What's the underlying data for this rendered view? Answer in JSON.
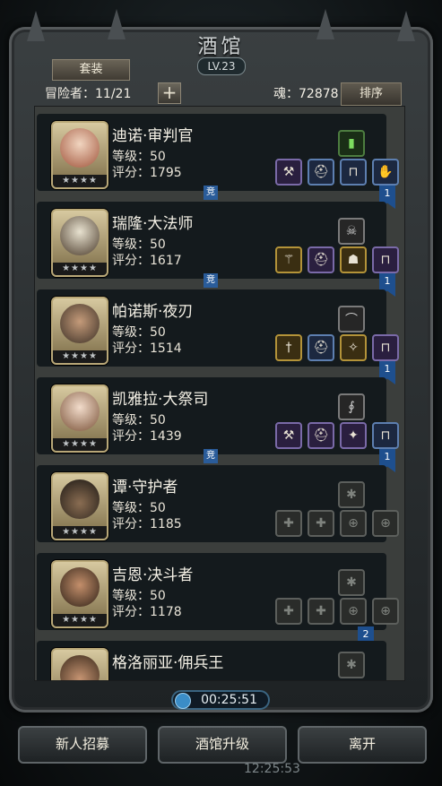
{
  "header": {
    "title": "酒馆",
    "level": "LV.23",
    "suit_button": "套装",
    "adventurer_count": "冒险者：11/21",
    "add_button": "+",
    "soul": "魂：72878",
    "sort_button": "排序"
  },
  "heroes": [
    {
      "name": "迪诺·审判官",
      "level": "等级：50",
      "score": "评分：1795",
      "stars": "★★★★",
      "badge": "1",
      "jing": "竞"
    },
    {
      "name": "瑞隆·大法师",
      "level": "等级：50",
      "score": "评分：1617",
      "stars": "★★★★",
      "badge": "1",
      "jing": "竞"
    },
    {
      "name": "帕诺斯·夜刃",
      "level": "等级：50",
      "score": "评分：1514",
      "stars": "★★★★",
      "badge": "1",
      "jing": ""
    },
    {
      "name": "凯雅拉·大祭司",
      "level": "等级：50",
      "score": "评分：1439",
      "stars": "★★★★",
      "badge": "1",
      "jing": "竞"
    },
    {
      "name": "谭·守护者",
      "level": "等级：50",
      "score": "评分：1185",
      "stars": "★★★★",
      "badge": "",
      "jing": ""
    },
    {
      "name": "吉恩·决斗者",
      "level": "等级：50",
      "score": "评分：1178",
      "stars": "★★★★",
      "badge": "2",
      "jing": ""
    },
    {
      "name": "格洛丽亚·佣兵王",
      "level": "",
      "score": "",
      "stars": "",
      "badge": "",
      "jing": ""
    }
  ],
  "footer": {
    "timer": "00:25:51",
    "recruit_button": "新人招募",
    "upgrade_button": "酒馆升级",
    "leave_button": "离开",
    "clock": "12:25:53"
  },
  "colors": {
    "accent": "#1e4f8e",
    "frame": "#3a3f41"
  }
}
